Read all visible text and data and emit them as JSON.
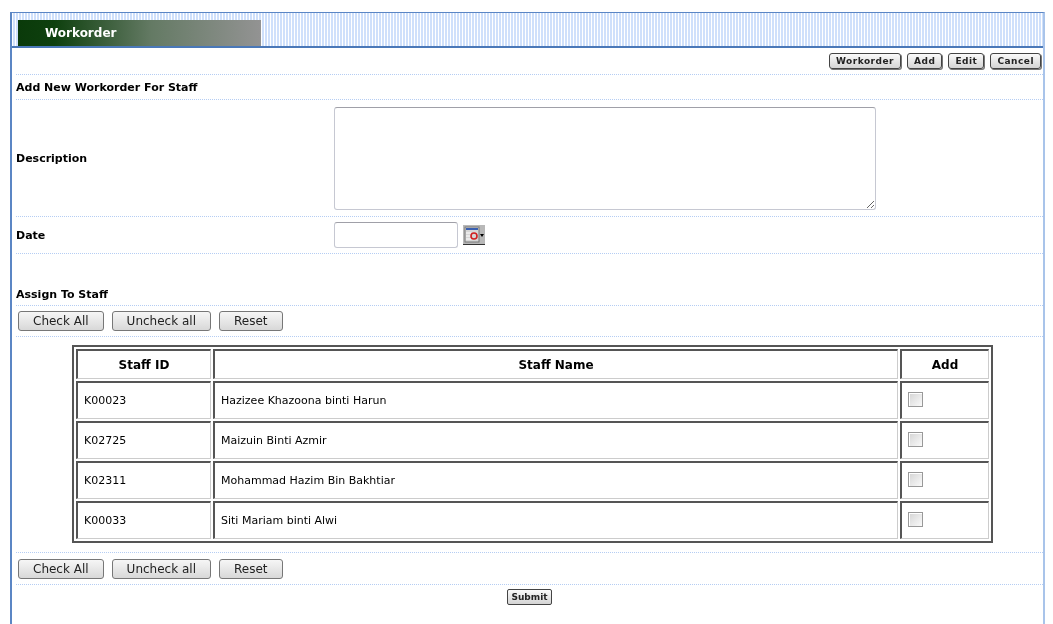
{
  "header": {
    "title": "Workorder"
  },
  "toolbar": [
    "Workorder",
    "Add",
    "Edit",
    "Cancel"
  ],
  "form": {
    "heading": "Add New Workorder For Staff",
    "fields": [
      {
        "label": "Description",
        "kind": "textarea"
      },
      {
        "label": "Date",
        "kind": "date"
      }
    ]
  },
  "assign": {
    "heading": "Assign To Staff",
    "buttons_top": [
      "Check All",
      "Uncheck all",
      "Reset"
    ],
    "table": {
      "columns": [
        "Staff ID",
        "Staff Name",
        "Add"
      ],
      "rows": [
        {
          "id": "K00023",
          "name": "Hazizee Khazoona binti Harun",
          "checked": false
        },
        {
          "id": "K02725",
          "name": "Maizuin Binti Azmir",
          "checked": false
        },
        {
          "id": "K02311",
          "name": "Mohammad Hazim Bin Bakhtiar",
          "checked": false
        },
        {
          "id": "K00033",
          "name": "Siti Mariam binti Alwi",
          "checked": false
        }
      ]
    },
    "buttons_bottom": [
      "Check All",
      "Uncheck all",
      "Reset"
    ]
  },
  "submit": "Submit"
}
